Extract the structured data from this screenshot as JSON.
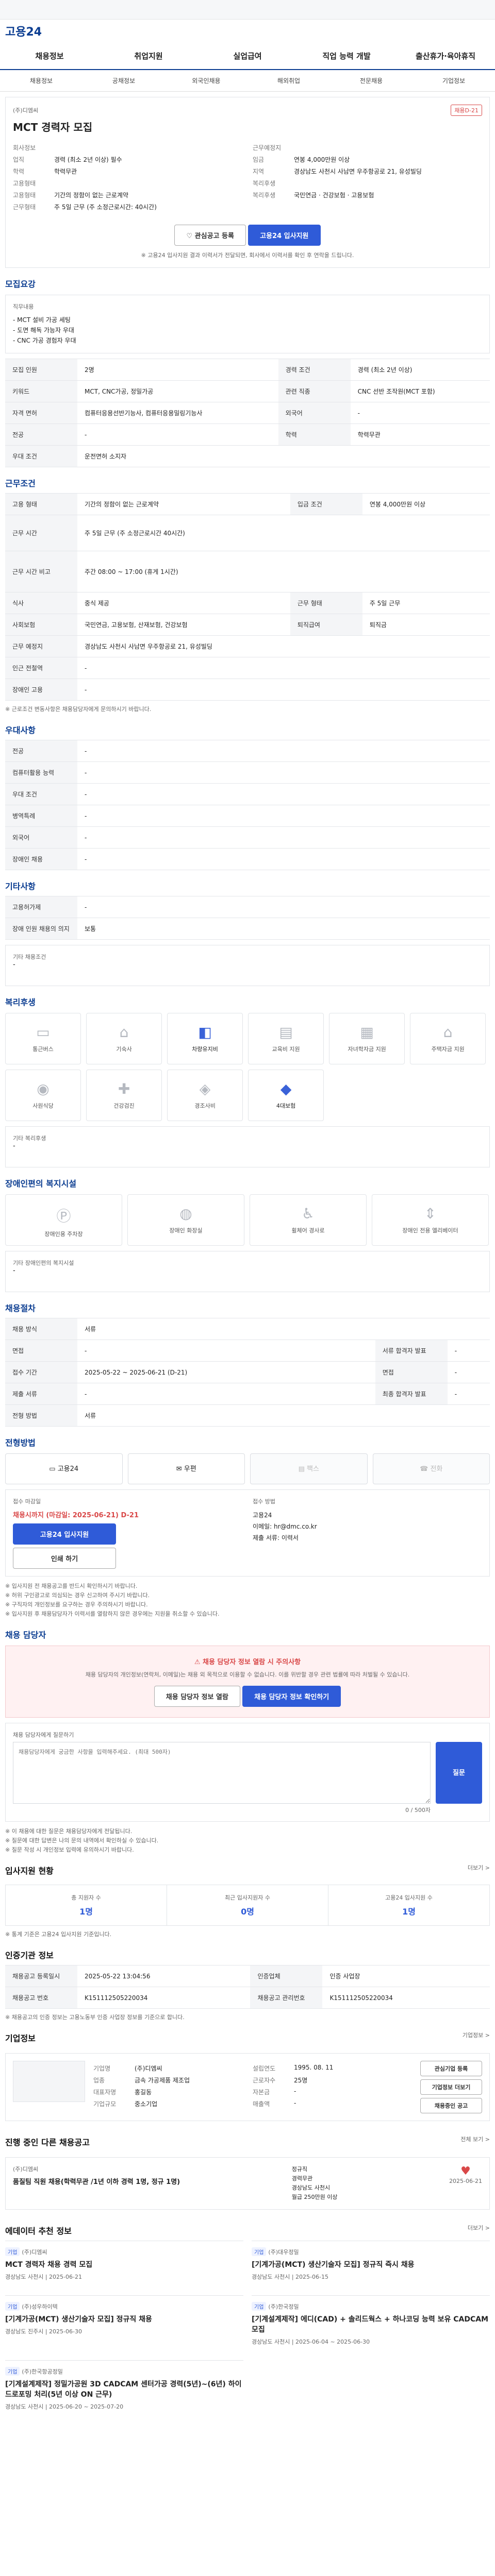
{
  "header": {
    "logo": "고용24"
  },
  "nav": [
    "채용정보",
    "취업지원",
    "실업급여",
    "직업 능력 개발",
    "출산휴가·육아휴직"
  ],
  "subnav": [
    "채용정보",
    "공채정보",
    "외국인채용",
    "해외취업",
    "전문채용",
    "기업정보"
  ],
  "job": {
    "company_label": "회사정보",
    "company_name": "(주)디엠씨",
    "badge": "채용D-21",
    "title": "MCT 경력자 모집",
    "left_kv": [
      {
        "k": "회사정보",
        "v": ""
      },
      {
        "k": "업직",
        "v": "경력 (최소 2년 이상) 필수"
      },
      {
        "k": "학력",
        "v": "학력무관"
      },
      {
        "k": "고용형태",
        "v": ""
      },
      {
        "k": "고용형태",
        "v": "기간의 정함이 없는 근로계약"
      },
      {
        "k": "근무형태",
        "v": "주 5일 근무 (주 소정근로시간: 40시간)"
      }
    ],
    "right_kv": [
      {
        "k": "근무예정지",
        "v": ""
      },
      {
        "k": "임금",
        "v": "연봉 4,000만원 이상"
      },
      {
        "k": "지역",
        "v": "경상남도 사천시 사남면 우주항공로 21, 유성빌딩"
      },
      {
        "k": "복리후생",
        "v": ""
      },
      {
        "k": "복리후생",
        "v": "국민연금 · 건강보험 · 고용보험"
      },
      {
        "k": "",
        "v": ""
      }
    ],
    "buttons": {
      "save": "관심공고 등록",
      "apply": "고용24 입사지원"
    },
    "note": "※ 고용24 입사지원 결과 이력서가 전달되면, 회사에서 이력서를 확인 후 연락을 드립니다."
  },
  "sections": {
    "recruit": {
      "title": "모집요강",
      "duty_label": "직무내용",
      "duties": [
        "MCT 설비 가공 세팅",
        "도면 해독 가능자 우대",
        "CNC 가공 경험자 우대"
      ],
      "rows": [
        [
          "모집 인원",
          "2명",
          "경력 조건",
          "경력 (최소 2년 이상)"
        ],
        [
          "키워드",
          "MCT, CNC가공, 정밀가공",
          "관련 직종",
          "CNC 선반 조작원(MCT 포함)"
        ],
        [
          "자격 면허",
          "컴퓨터응용선반기능사, 컴퓨터응용밀링기능사",
          "외국어",
          "-"
        ],
        [
          "전공",
          "-",
          "학력",
          "학력무관"
        ],
        [
          "우대 조건",
          "운전면허 소지자",
          "",
          ""
        ]
      ]
    },
    "work": {
      "title": "근무조건",
      "rows": [
        [
          "고용 형태",
          "기간의 정함이 없는 근로계약",
          "입금 조건",
          "연봉 4,000만원 이상"
        ],
        [
          "근무 시간",
          "주 5일 근무 (주 소정근로시간 40시간)",
          "",
          ""
        ],
        [
          "근무 시간 비고",
          "주간 08:00 ~ 17:00 (휴게 1시간)",
          "",
          ""
        ],
        [
          "식사",
          "중식 제공",
          "근무 형태",
          "주 5일 근무"
        ],
        [
          "사회보험",
          "국민연금, 고용보험, 산재보험, 건강보험",
          "퇴직급여",
          "퇴직금"
        ],
        [
          "근무 예정지",
          "경상남도 사천시 사남면 우주항공로 21, 유성빌딩",
          "",
          ""
        ],
        [
          "인근 전철역",
          "-",
          "",
          ""
        ],
        [
          "장애인 고용",
          "-",
          "",
          ""
        ]
      ],
      "note": "※ 근로조건 변동사항은 채용담당자에게 문의하시기 바랍니다."
    },
    "welfare": {
      "title": "우대사항",
      "rows": [
        [
          "전공",
          "-"
        ],
        [
          "컴퓨터활용 능력",
          "-"
        ],
        [
          "우대 조건",
          "-"
        ],
        [
          "병역특례",
          "-"
        ],
        [
          "외국어",
          "-"
        ],
        [
          "장애인 채용",
          "-"
        ]
      ]
    },
    "etc": {
      "title": "기타사항",
      "rows": [
        [
          "고용허가제",
          "-"
        ],
        [
          "장애 인원 채용의 의지",
          "보통"
        ]
      ],
      "extra_label": "기타 채용조건",
      "extra": "-"
    },
    "benefits": {
      "title": "복리후생",
      "items": [
        {
          "label": "통근버스",
          "on": false,
          "icon": "bus-icon"
        },
        {
          "label": "기숙사",
          "on": false,
          "icon": "house-icon"
        },
        {
          "label": "차량유지비",
          "on": true,
          "icon": "car-icon"
        },
        {
          "label": "교육비 지원",
          "on": false,
          "icon": "book-icon"
        },
        {
          "label": "자녀학자금 지원",
          "on": false,
          "icon": "school-icon"
        },
        {
          "label": "주택자금 지원",
          "on": false,
          "icon": "home-icon"
        },
        {
          "label": "사원식당",
          "on": false,
          "icon": "food-icon"
        },
        {
          "label": "건강검진",
          "on": false,
          "icon": "health-icon"
        },
        {
          "label": "경조사비",
          "on": false,
          "icon": "gift-icon"
        },
        {
          "label": "4대보험",
          "on": true,
          "icon": "shield-icon"
        }
      ],
      "etc_label": "기타 복리후생",
      "etc_value": "-"
    },
    "disability": {
      "title": "장애인편의 복지시설",
      "items": [
        {
          "label": "장애인용 주차장",
          "icon": "parking-icon"
        },
        {
          "label": "장애인 화장실",
          "icon": "restroom-icon"
        },
        {
          "label": "휠체어 경사로",
          "icon": "wheelchair-icon"
        },
        {
          "label": "장애인 전용 엘리베이터",
          "icon": "elevator-icon"
        }
      ],
      "etc_label": "기타 장애인편의 복지시설",
      "etc_value": "-"
    },
    "process": {
      "title": "채용절차",
      "rows": [
        [
          "채용 방식",
          "서류"
        ],
        [
          "면접",
          "-"
        ],
        [
          "접수 기간",
          "2025-05-22 ~ 2025-06-21 (D-21)"
        ],
        [
          "제출 서류",
          "-"
        ],
        [
          "전형 방법",
          "서류"
        ]
      ],
      "right_rows": [
        [
          "서류 합격자 발표",
          "-"
        ],
        [
          "면접",
          "-"
        ],
        [
          "최종 합격자 발표",
          "-"
        ]
      ]
    },
    "apply": {
      "title": "전형방법",
      "methods": [
        {
          "label": "고용24",
          "off": false
        },
        {
          "label": "우편",
          "off": false
        },
        {
          "label": "팩스",
          "off": true
        },
        {
          "label": "전화",
          "off": true
        }
      ],
      "left_label": "접수 마감일",
      "deadline": "채용시까지 (마감일: 2025-06-21) D-21",
      "apply_btn": "고용24 입사지원",
      "print_btn": "인쇄 하기",
      "right_label": "접수 방법",
      "right_lines": [
        "고용24",
        "이메일: hr@dmc.co.kr",
        "제출 서류: 이력서"
      ],
      "notes": [
        "※ 입사지원 전 채용공고를 반드시 확인하시기 바랍니다.",
        "※ 허위 구인광고로 의심되는 경우 신고하여 주시기 바랍니다.",
        "※ 구직자의 개인정보를 요구하는 경우 주의하시기 바랍니다.",
        "※ 입사지원 후 채용담당자가 이력서를 열람하지 않은 경우에는 지원을 취소할 수 있습니다."
      ]
    },
    "contact": {
      "title": "채용 담당자",
      "notice_title": "채용 담당자 정보 열람 시 주의사항",
      "notice": "채용 담당자의 개인정보(연락처, 이메일)는 채용 외 목적으로 이용할 수 없습니다. 이를 위반할 경우 관련 법률에 따라 처벌될 수 있습니다.",
      "btn1": "채용 담당자 정보 열람",
      "btn2": "채용 담당자 정보 확인하기",
      "question_label": "채용 담당자에게 질문하기",
      "placeholder": "채용담당자에게 궁금한 사항을 입력해주세요. (최대 500자)",
      "count": "0 / 500자",
      "send": "질문",
      "notes": [
        "※ 이 채용에 대한 질문은 채용담당자에게 전달됩니다.",
        "※ 질문에 대한 답변은 나의 문의 내역에서 확인하실 수 있습니다.",
        "※ 질문 작성 시 개인정보 입력에 유의하시기 바랍니다."
      ],
      "more": "채용 담당자 질문"
    },
    "stats": {
      "title": "입사지원 현황",
      "more": "더보기 >",
      "items": [
        {
          "label": "총 지원자 수",
          "n": "1명"
        },
        {
          "label": "최근 입사지원자 수",
          "n": "0명"
        },
        {
          "label": "고용24 입사지원 수",
          "n": "1명"
        }
      ],
      "note": "※ 통계 기준은 고용24 입사지원 기준입니다."
    },
    "reg": {
      "title": "인증기관 정보",
      "rows": [
        [
          "채용공고 등록일시",
          "2025-05-22 13:04:56",
          "인증업체",
          "인증 사업장"
        ],
        [
          "채용공고 번호",
          "K151112505220034",
          "채용공고 관리번호",
          "K151112505220034"
        ]
      ],
      "note": "※ 채용공고의 인증 정보는 고용노동부 인증 사업장 정보를 기준으로 합니다."
    },
    "company": {
      "title": "기업정보",
      "more": "기업정보 >",
      "rows": [
        [
          "기업명",
          "(주)디엠씨",
          "설립연도",
          "1995. 08. 11"
        ],
        [
          "업종",
          "금속 가공제품 제조업",
          "근로자수",
          "25명"
        ],
        [
          "대표자명",
          "홍길동",
          "자본금",
          "-"
        ],
        [
          "기업규모",
          "중소기업",
          "매출액",
          "-"
        ]
      ],
      "btns": [
        "관심기업 등록",
        "기업정보 더보기",
        "채용중인 공고"
      ]
    },
    "similar": {
      "title": "진행 중인 다른 채용공고",
      "more": "전체 보기 >",
      "company": "(주)디엠씨",
      "job": "품질팀 직원 채용(학력무관 /1년 이하 경력 1명, 정규 1명)",
      "tags": [
        "정규직",
        "경력무관",
        "경상남도 사천시",
        "월급 250만원 이상"
      ],
      "deadline": "2025-06-21"
    },
    "recommend": {
      "title": "에데이터 추천 정보",
      "more": "더보기 >",
      "items": [
        {
          "co": "(주)디엠씨",
          "t": "MCT 경력자 채용 경력 모집",
          "meta": "경상남도 사천시 | 2025-06-21"
        },
        {
          "co": "(주)대우정밀",
          "t": "[기계가공(MCT) 생산기술자 모집] 정규직 즉시 채용",
          "meta": "경상남도 사천시 | 2025-06-15"
        },
        {
          "co": "(주)성우하이텍",
          "t": "[기계가공(MCT) 생산기술자 모집] 정규직 채용",
          "meta": "경상남도 진주시 | 2025-06-30"
        },
        {
          "co": "(주)한국정밀",
          "t": "[기계설계제작] 에디(CAD) + 솔리드웍스 + 하나코딩 능력 보유 CADCAM 모집",
          "meta": "경상남도 사천시 | 2025-06-04 ~ 2025-06-30"
        },
        {
          "co": "(주)한국항공정밀",
          "t": "[기계설계제작] 정밀가공원 3D CADCAM 센터가공 경력(5년)~(6년) 하이드로포밍 처리(5년 이상 ON 근무)",
          "meta": "경상남도 사천시 | 2025-06-20 ~ 2025-07-20"
        }
      ]
    }
  }
}
